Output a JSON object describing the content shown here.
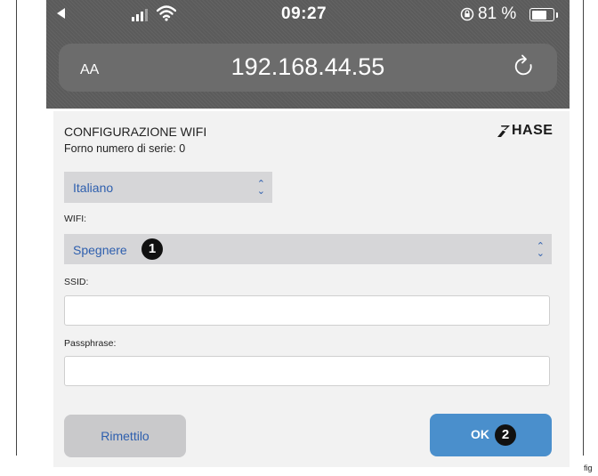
{
  "status_bar": {
    "time": "09:27",
    "battery_percent": "81 %",
    "battery_level": 0.81,
    "icons": [
      "back-arrow-icon",
      "cellular-signal-icon",
      "wifi-icon",
      "orientation-lock-icon",
      "battery-icon"
    ]
  },
  "browser": {
    "text_size_label": "AA",
    "url": "192.168.44.55",
    "reload_icon": "reload-icon"
  },
  "page": {
    "title": "CONFIGURAZIONE WIFI",
    "serial": "Forno numero di serie: 0",
    "brand": "HASE",
    "language_select": {
      "value": "Italiano"
    },
    "wifi_label": "WIFI:",
    "wifi_select": {
      "value": "Spegnere",
      "callout": "1"
    },
    "ssid_label": "SSID:",
    "ssid_value": "",
    "passphrase_label": "Passphrase:",
    "passphrase_value": "",
    "reset_button": "Rimettilo",
    "ok_button": "OK",
    "ok_callout": "2"
  },
  "figure_label": "fig",
  "colors": {
    "accent_blue": "#4a8fcc",
    "select_text": "#2e5fae",
    "header_gray": "#5b5b5b"
  }
}
